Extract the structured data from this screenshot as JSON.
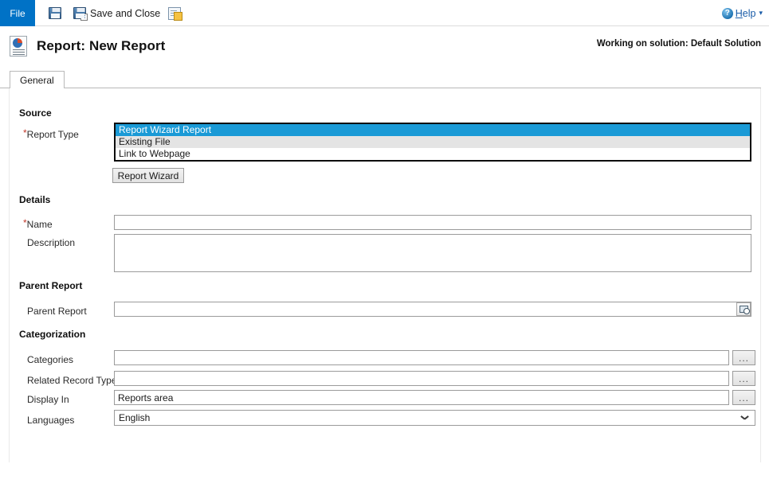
{
  "ribbon": {
    "file_tab": "File",
    "save_button_label": "",
    "save_and_close_label": "Save and Close",
    "save_as_new_label": "",
    "help_label": "Help",
    "help_accesskey": "H",
    "help_caret": "▾",
    "help_icon_glyph": "?"
  },
  "header": {
    "title": "Report: New Report",
    "solution_note": "Working on solution: Default Solution"
  },
  "tabs": [
    {
      "label": "General",
      "active": true
    }
  ],
  "form": {
    "sections": [
      {
        "title": "Source"
      },
      {
        "title": "Details"
      },
      {
        "title": "Parent Report"
      },
      {
        "title": "Categorization"
      }
    ],
    "report_type": {
      "label": "Report Type",
      "required": true,
      "options": [
        {
          "label": "Report Wizard Report",
          "selected": true
        },
        {
          "label": "Existing File",
          "selected": false
        },
        {
          "label": "Link to Webpage",
          "selected": false
        }
      ],
      "wizard_button": "Report Wizard"
    },
    "name": {
      "label": "Name",
      "required": true,
      "value": "",
      "placeholder": ""
    },
    "description": {
      "label": "Description",
      "required": false,
      "value": "",
      "placeholder": ""
    },
    "parent_report": {
      "label": "Parent Report",
      "value": "",
      "placeholder": "",
      "lookup_icon": "lookup-icon"
    },
    "categories": {
      "label": "Categories",
      "value": "",
      "placeholder": "",
      "browse_button": "..."
    },
    "related_record_types": {
      "label": "Related Record Types",
      "value": "",
      "placeholder": "",
      "browse_button": "..."
    },
    "display_in": {
      "label": "Display In",
      "value": "Reports area",
      "placeholder": "",
      "browse_button": "..."
    },
    "languages": {
      "label": "Languages",
      "value": "English",
      "options": [
        "English"
      ]
    }
  },
  "colors": {
    "accent_blue": "#0072c6",
    "selection_blue": "#1a9ad6",
    "required_red": "#c2392b",
    "link_blue": "#1a5ca8"
  }
}
